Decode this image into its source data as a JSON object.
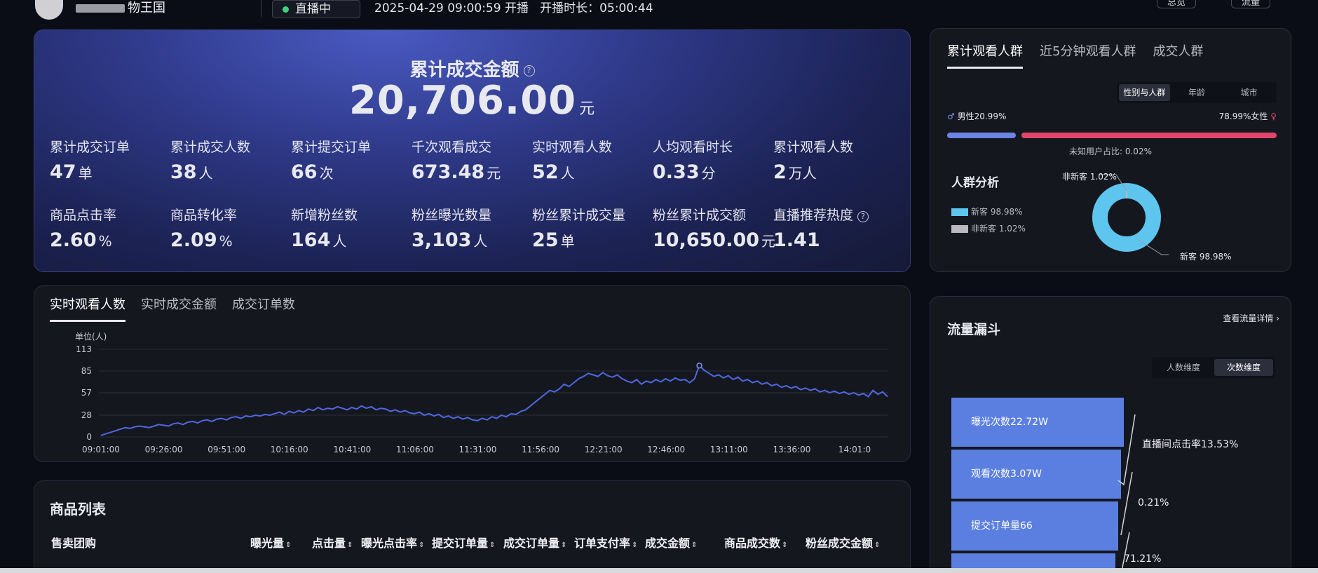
{
  "topbar": {
    "shop_name": "物王国",
    "live_status": "直播中",
    "start_time": "2025-04-29 09:00:59 开播",
    "duration": "开播时长：05:00:44",
    "btn1": "总览",
    "btn2": "流量"
  },
  "hero": {
    "title": "累计成交金额",
    "total_value": "20,706.00",
    "total_unit": "元",
    "metrics": [
      {
        "label": "累计成交订单",
        "value": "47",
        "unit": "单"
      },
      {
        "label": "累计成交人数",
        "value": "38",
        "unit": "人"
      },
      {
        "label": "累计提交订单",
        "value": "66",
        "unit": "次"
      },
      {
        "label": "千次观看成交",
        "value": "673.48",
        "unit": "元"
      },
      {
        "label": "实时观看人数",
        "value": "52",
        "unit": "人"
      },
      {
        "label": "人均观看时长",
        "value": "0.33",
        "unit": "分"
      },
      {
        "label": "累计观看人数",
        "value": "2",
        "unit": "万人"
      },
      {
        "label": "商品点击率",
        "value": "2.60",
        "unit": "%"
      },
      {
        "label": "商品转化率",
        "value": "2.09",
        "unit": "%"
      },
      {
        "label": "新增粉丝数",
        "value": "164",
        "unit": "人"
      },
      {
        "label": "粉丝曝光数量",
        "value": "3,103",
        "unit": "人"
      },
      {
        "label": "粉丝累计成交量",
        "value": "25",
        "unit": "单"
      },
      {
        "label": "粉丝累计成交额",
        "value": "10,650.00",
        "unit": "元"
      },
      {
        "label": "直播推荐热度",
        "value": "1.41",
        "unit": ""
      }
    ]
  },
  "chart_tabs": [
    "实时观看人数",
    "实时成交金额",
    "成交订单数"
  ],
  "chart_data": {
    "type": "line",
    "ylabel": "单位(人)",
    "ylim": [
      0,
      113
    ],
    "yticks": [
      0,
      28,
      57,
      85,
      113
    ],
    "xticks": [
      "09:01:00",
      "09:26:00",
      "09:51:00",
      "10:16:00",
      "10:41:00",
      "11:06:00",
      "11:31:00",
      "11:56:00",
      "12:21:00",
      "12:46:00",
      "13:11:00",
      "13:36:00",
      "14:01:0"
    ],
    "series": [
      {
        "values": [
          2,
          4,
          6,
          8,
          10,
          12,
          11,
          13,
          14,
          13,
          12,
          14,
          16,
          15,
          14,
          17,
          18,
          16,
          19,
          20,
          18,
          21,
          22,
          20,
          23,
          24,
          22,
          25,
          26,
          24,
          27,
          26,
          28,
          27,
          29,
          28,
          30,
          32,
          29,
          33,
          31,
          34,
          32,
          36,
          34,
          38,
          35,
          37,
          36,
          39,
          37,
          35,
          38,
          36,
          40,
          37,
          39,
          35,
          37,
          36,
          33,
          35,
          32,
          34,
          31,
          30,
          32,
          28,
          30,
          27,
          29,
          25,
          27,
          24,
          26,
          23,
          25,
          22,
          21,
          24,
          22,
          26,
          24,
          28,
          26,
          30,
          29,
          33,
          35,
          40,
          45,
          50,
          55,
          60,
          58,
          62,
          68,
          65,
          70,
          75,
          78,
          82,
          80,
          78,
          83,
          79,
          77,
          80,
          75,
          72,
          70,
          74,
          68,
          72,
          70,
          74,
          71,
          75,
          72,
          76,
          73,
          74,
          70,
          75,
          92,
          86,
          82,
          78,
          80,
          76,
          79,
          74,
          77,
          72,
          74,
          70,
          72,
          68,
          70,
          66,
          68,
          64,
          66,
          63,
          65,
          61,
          63,
          60,
          62,
          58,
          60,
          57,
          59,
          56,
          58,
          55,
          57,
          54,
          56,
          52,
          60,
          55,
          58,
          52
        ]
      }
    ]
  },
  "product_list": {
    "title": "商品列表",
    "columns": [
      "售卖团购",
      "曝光量",
      "点击量",
      "曝光点击率",
      "提交订单量",
      "成交订单量",
      "订单支付率",
      "成交金额",
      "商品成交数",
      "粉丝成交金额"
    ]
  },
  "audience": {
    "tabs": [
      "累计观看人群",
      "近5分钟观看人群",
      "成交人群"
    ],
    "segments": [
      "性别与人群",
      "年龄",
      "城市"
    ],
    "male": "男性20.99%",
    "female": "78.99%女性",
    "unknown": "未知用户占比: 0.02%",
    "analysis_title": "人群分析",
    "legend": [
      {
        "name": "新客 98.98%",
        "color": "#5ec5ef"
      },
      {
        "name": "非新客 1.02%",
        "color": "#b9b9bf"
      }
    ],
    "donut_label_top": "非新客 1.02%",
    "donut_label_bottom": "新客 98.98%",
    "donut": [
      98.98,
      1.02
    ]
  },
  "funnel": {
    "title": "流量漏斗",
    "link": "查看流量详情",
    "segments": [
      "人数维度",
      "次数维度"
    ],
    "steps": [
      "曝光次数22.72W",
      "观看次数3.07W",
      "提交订单量66"
    ],
    "rates": [
      "直播间点击率13.53%",
      "0.21%",
      "71.21%"
    ]
  }
}
